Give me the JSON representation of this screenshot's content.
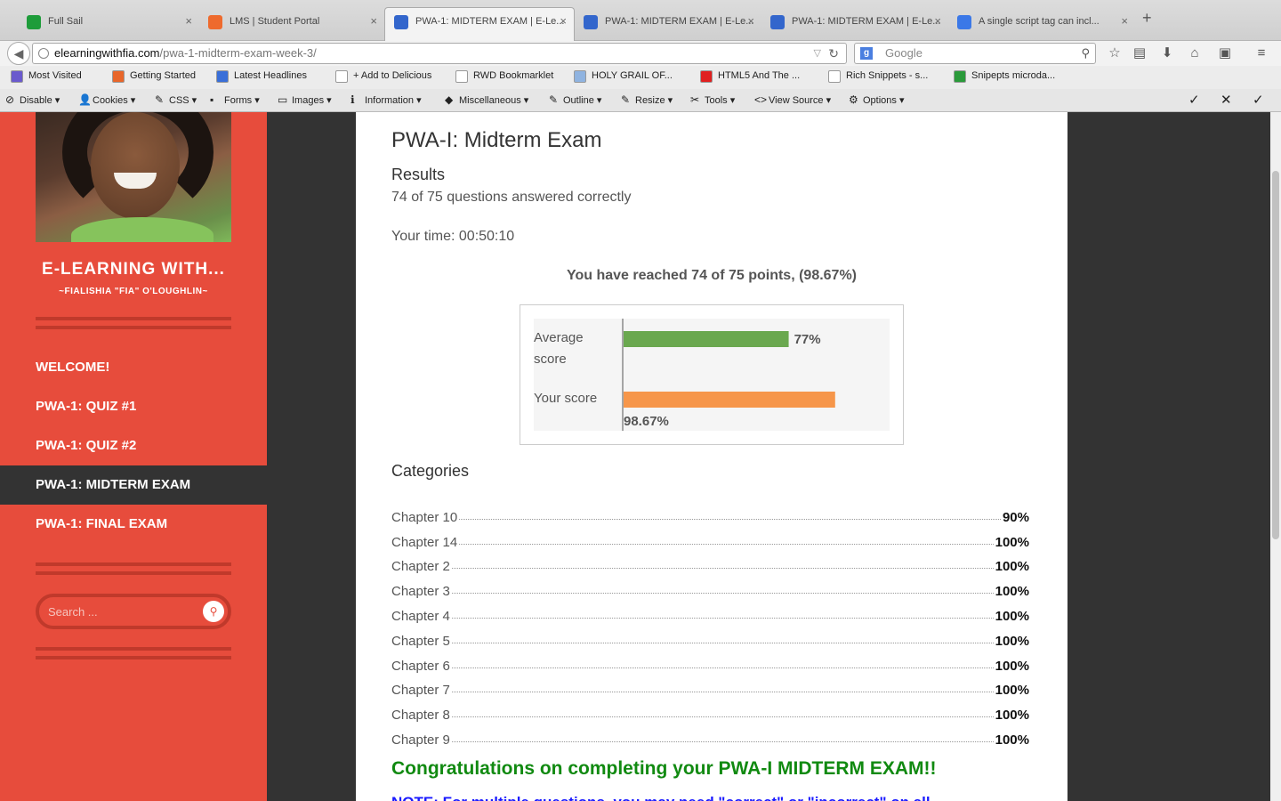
{
  "browser": {
    "tabs": [
      {
        "label": "Full Sail",
        "color": "#1e9c3a"
      },
      {
        "label": "LMS | Student Portal",
        "color": "#ee6a2d"
      },
      {
        "label": "PWA-1: MIDTERM EXAM | E-Le...",
        "color": "#3366cc",
        "active": true
      },
      {
        "label": "PWA-1: MIDTERM EXAM | E-Le...",
        "color": "#3366cc"
      },
      {
        "label": "PWA-1: MIDTERM EXAM | E-Le...",
        "color": "#3366cc"
      },
      {
        "label": "A single script tag can incl...",
        "color": "#3b78e7"
      }
    ],
    "new_tab": "+",
    "tab_close": "×",
    "url_host": "elearningwithfia.com",
    "url_path": "/pwa-1-midterm-exam-week-3/",
    "search_placeholder": "Google",
    "search_engine_badge": "g"
  },
  "bookmarks": [
    {
      "label": "Most Visited",
      "color": "#6a5acd"
    },
    {
      "label": "Getting Started",
      "color": "#e8662a"
    },
    {
      "label": "Latest Headlines",
      "color": "#3a6fd8"
    },
    {
      "label": "+ Add to Delicious",
      "color": "#ffffff"
    },
    {
      "label": "RWD Bookmarklet",
      "color": "#ffffff"
    },
    {
      "label": "HOLY GRAIL OF...",
      "color": "#8fb3e0"
    },
    {
      "label": "HTML5 And The ...",
      "color": "#e02020"
    },
    {
      "label": "Rich Snippets - s...",
      "color": "#ffffff"
    },
    {
      "label": "Snipepts microda...",
      "color": "#2a9a3a"
    }
  ],
  "devbar": [
    {
      "label": "Disable",
      "icon": "⊘"
    },
    {
      "label": "Cookies",
      "icon": "👤"
    },
    {
      "label": "CSS",
      "icon": "✎"
    },
    {
      "label": "Forms",
      "icon": "▪"
    },
    {
      "label": "Images",
      "icon": "▭"
    },
    {
      "label": "Information",
      "icon": "ℹ"
    },
    {
      "label": "Miscellaneous",
      "icon": "◆"
    },
    {
      "label": "Outline",
      "icon": "✎"
    },
    {
      "label": "Resize",
      "icon": "✎"
    },
    {
      "label": "Tools",
      "icon": "✂"
    },
    {
      "label": "View Source",
      "icon": "<>"
    },
    {
      "label": "Options",
      "icon": "⚙"
    }
  ],
  "sidebar": {
    "site_title": "E-LEARNING WITH...",
    "site_subtitle": "~FIALISHIA \"FIA\" O'LOUGHLIN~",
    "menu": [
      {
        "label": "WELCOME!"
      },
      {
        "label": "PWA-1: QUIZ #1"
      },
      {
        "label": "PWA-1: QUIZ #2"
      },
      {
        "label": "PWA-1: MIDTERM EXAM",
        "active": true
      },
      {
        "label": "PWA-1: FINAL EXAM"
      }
    ],
    "search_placeholder": "Search ..."
  },
  "content": {
    "title": "PWA-I: Midterm Exam",
    "results_heading": "Results",
    "correct_text": "74 of 75 questions answered correctly",
    "time_text": "Your time: 00:50:10",
    "reached_text": "You have reached 74 of 75 points, (98.67%)",
    "categories_heading": "Categories",
    "categories": [
      {
        "name": "Chapter 10",
        "value": "90%"
      },
      {
        "name": "Chapter 14",
        "value": "100%"
      },
      {
        "name": "Chapter 2",
        "value": "100%"
      },
      {
        "name": "Chapter 3",
        "value": "100%"
      },
      {
        "name": "Chapter 4",
        "value": "100%"
      },
      {
        "name": "Chapter 5",
        "value": "100%"
      },
      {
        "name": "Chapter 6",
        "value": "100%"
      },
      {
        "name": "Chapter 7",
        "value": "100%"
      },
      {
        "name": "Chapter 8",
        "value": "100%"
      },
      {
        "name": "Chapter 9",
        "value": "100%"
      }
    ],
    "congrats": "Congratulations on completing your PWA-I MIDTERM EXAM!!",
    "note": "NOTE: For multiple questions, you may need \"correct\" or \"incorrect\" on all"
  },
  "chart_data": {
    "type": "bar",
    "orientation": "horizontal",
    "categories": [
      "Average score",
      "Your score"
    ],
    "values": [
      77,
      98.67
    ],
    "value_labels": [
      "77%",
      "98.67%"
    ],
    "colors": [
      "#6aa84f",
      "#f6964a"
    ],
    "xlim": [
      0,
      100
    ]
  }
}
